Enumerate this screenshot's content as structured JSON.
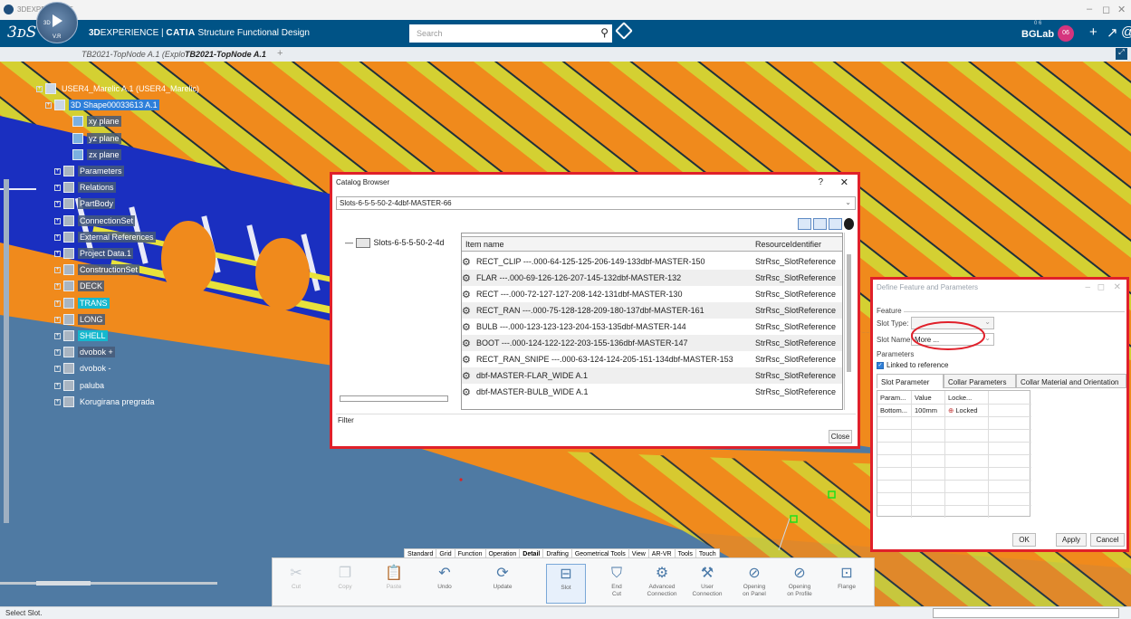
{
  "window": {
    "title": "3DEXPERIENCE"
  },
  "header": {
    "brand_bold": "3D",
    "brand_rest": "EXPERIENCE | ",
    "app_name": "CATIA",
    "app_role": "Structure Functional Design",
    "search_placeholder": "Search",
    "compass_version": "V.R",
    "compass_label": "3D",
    "tenant": "BGLab",
    "tenant_sub": "0 6",
    "avatar_initials": "06",
    "brand_color": "#005386"
  },
  "tabs": {
    "tab1": "TB2021-TopNode A.1 (Explo",
    "tab2": "TB2021-TopNode A.1"
  },
  "tree": {
    "items": [
      {
        "label": "USER4_Marelic A.1 (USER4_Marelic)",
        "style": "plain"
      },
      {
        "label": "3D Shape00033613 A.1",
        "style": "sel"
      },
      {
        "label": "xy plane",
        "style": "n"
      },
      {
        "label": "yz plane",
        "style": "n"
      },
      {
        "label": "zx plane",
        "style": "n"
      },
      {
        "label": "Parameters",
        "style": "n"
      },
      {
        "label": "Relations",
        "style": "n"
      },
      {
        "label": "PartBody",
        "style": "n"
      },
      {
        "label": "ConnectionSet",
        "style": "n"
      },
      {
        "label": "External References",
        "style": "n"
      },
      {
        "label": "Project Data.1",
        "style": "n"
      },
      {
        "label": "ConstructionSet",
        "style": "n"
      },
      {
        "label": "DECK",
        "style": "n"
      },
      {
        "label": "TRANS",
        "style": "cy"
      },
      {
        "label": "LONG",
        "style": "n"
      },
      {
        "label": "SHELL",
        "style": "cy"
      },
      {
        "label": "dvobok +",
        "style": "n"
      },
      {
        "label": "dvobok -",
        "style": "plain"
      },
      {
        "label": "paluba",
        "style": "plain"
      },
      {
        "label": "Korugirana pregrada",
        "style": "plain"
      }
    ]
  },
  "catalog": {
    "title": "Catalog Browser",
    "help": "?",
    "close_glyph": "✕",
    "selected": "Slots-6-5-5-50-2-4dbf-MASTER-66",
    "tree_node": "Slots-6-5-5-50-2-4d",
    "col_name": "Item name",
    "col_res": "ResourceIdentifier",
    "rows": [
      {
        "name": "RECT_CLIP ---.000-64-125-125-206-149-133dbf-MASTER-150",
        "res": "StrRsc_SlotReference"
      },
      {
        "name": "FLAR ---.000-69-126-126-207-145-132dbf-MASTER-132",
        "res": "StrRsc_SlotReference"
      },
      {
        "name": "RECT ---.000-72-127-127-208-142-131dbf-MASTER-130",
        "res": "StrRsc_SlotReference"
      },
      {
        "name": "RECT_RAN ---.000-75-128-128-209-180-137dbf-MASTER-161",
        "res": "StrRsc_SlotReference"
      },
      {
        "name": "BULB ---.000-123-123-123-204-153-135dbf-MASTER-144",
        "res": "StrRsc_SlotReference"
      },
      {
        "name": "BOOT ---.000-124-122-122-203-155-136dbf-MASTER-147",
        "res": "StrRsc_SlotReference"
      },
      {
        "name": "RECT_RAN_SNIPE ---.000-63-124-124-205-151-134dbf-MASTER-153",
        "res": "StrRsc_SlotReference"
      },
      {
        "name": "dbf-MASTER-FLAR_WIDE A.1",
        "res": "StrRsc_SlotReference"
      },
      {
        "name": "dbf-MASTER-BULB_WIDE A.1",
        "res": "StrRsc_SlotReference"
      }
    ],
    "filter": "Filter",
    "close_button": "Close"
  },
  "define": {
    "title": "Define Feature and Parameters",
    "feature_group": "Feature",
    "slot_type_label": "Slot Type:",
    "slot_type_value": "",
    "slot_name_label": "Slot Name:",
    "slot_name_value": "More ...",
    "parameters_group": "Parameters",
    "linked_label": "Linked to reference",
    "tab_slot": "Slot Parameter",
    "tab_collar": "Collar Parameters",
    "tab_material": "Collar Material and Orientation",
    "grid_head": [
      "Param...",
      "Value",
      "Locke..."
    ],
    "grid_row": [
      "Bottom...",
      "100mm",
      "Locked"
    ],
    "ok": "OK",
    "apply": "Apply",
    "cancel": "Cancel"
  },
  "actionbar": {
    "tabs": [
      "Standard",
      "Grid",
      "Function",
      "Operation",
      "Detail",
      "Drafting",
      "Geometrical Tools",
      "View",
      "AR-VR",
      "Tools",
      "Touch"
    ],
    "buttons": [
      {
        "label": "Cut",
        "icon": "scissors-icon",
        "dim": true
      },
      {
        "label": "Copy",
        "icon": "copy-icon",
        "dim": true
      },
      {
        "label": "Paste",
        "icon": "paste-icon",
        "dim": true
      },
      {
        "label": "Undo",
        "icon": "undo-icon",
        "dim": false
      },
      {
        "label": "Update",
        "icon": "update-icon",
        "dim": false
      },
      {
        "label": "Slot",
        "icon": "slot-icon",
        "dim": false
      },
      {
        "label": "End\nCut",
        "icon": "end-cut-icon",
        "dim": false
      },
      {
        "label": "Advanced\nConnection",
        "icon": "advanced-connection-icon",
        "dim": false
      },
      {
        "label": "User\nConnection",
        "icon": "user-connection-icon",
        "dim": false
      },
      {
        "label": "Opening\non Panel",
        "icon": "opening-panel-icon",
        "dim": false
      },
      {
        "label": "Opening\non Profile",
        "icon": "opening-profile-icon",
        "dim": false
      },
      {
        "label": "Flange",
        "icon": "flange-icon",
        "dim": false
      }
    ]
  },
  "status": {
    "text": "Select Slot."
  },
  "colors": {
    "highlight": "#e0202a",
    "accent": "#2f7fd8"
  }
}
